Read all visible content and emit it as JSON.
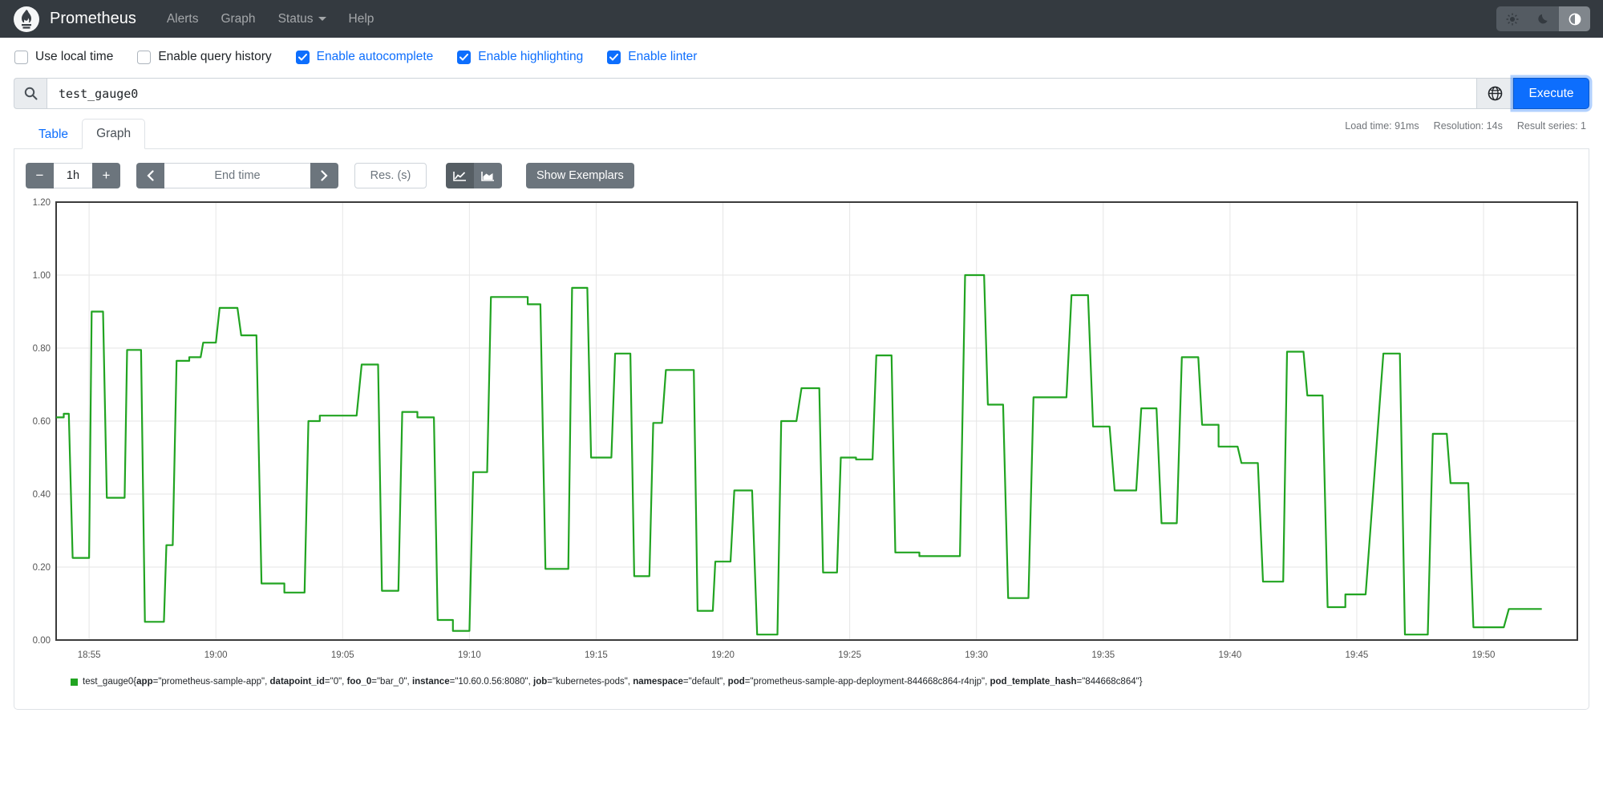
{
  "navbar": {
    "brand": "Prometheus",
    "links": [
      {
        "label": "Alerts",
        "caret": false
      },
      {
        "label": "Graph",
        "caret": false
      },
      {
        "label": "Status",
        "caret": true
      },
      {
        "label": "Help",
        "caret": false
      }
    ]
  },
  "options": [
    {
      "label": "Use local time",
      "checked": false
    },
    {
      "label": "Enable query history",
      "checked": false
    },
    {
      "label": "Enable autocomplete",
      "checked": true
    },
    {
      "label": "Enable highlighting",
      "checked": true
    },
    {
      "label": "Enable linter",
      "checked": true
    }
  ],
  "query": {
    "value": "test_gauge0",
    "execute_label": "Execute"
  },
  "stats": {
    "load_time": "Load time: 91ms",
    "resolution": "Resolution: 14s",
    "result_series": "Result series: 1"
  },
  "tabs": [
    {
      "label": "Table"
    },
    {
      "label": "Graph"
    }
  ],
  "controls": {
    "minus": "−",
    "plus": "+",
    "range": "1h",
    "prev": "‹",
    "next": "›",
    "end_time_placeholder": "End time",
    "res_placeholder": "Res. (s)",
    "show_exemplars": "Show Exemplars"
  },
  "chart_data": {
    "type": "line",
    "step": true,
    "title": "",
    "xlabel": "",
    "ylabel": "",
    "ylim": [
      0,
      1.2
    ],
    "grid": true,
    "line_color": "#21a421",
    "grid_color": "#e6e6e6",
    "border_color": "#3b3b3b",
    "tick_color": "#545454",
    "y_ticks": [
      "0.00",
      "0.20",
      "0.40",
      "0.60",
      "0.80",
      "1.00",
      "1.20"
    ],
    "x_ticks": [
      "18:55",
      "19:00",
      "19:05",
      "19:10",
      "19:15",
      "19:20",
      "19:25",
      "19:30",
      "19:35",
      "19:40",
      "19:45",
      "19:50"
    ],
    "time_domain_minutes": [
      53.7,
      113.7
    ],
    "series": [
      {
        "name": "test_gauge0",
        "segments": [
          [
            53.7,
            54,
            0.61
          ],
          [
            54,
            54.2,
            0.62
          ],
          [
            54.35,
            55,
            0.225
          ],
          [
            55.1,
            55.55,
            0.9
          ],
          [
            55.7,
            56.4,
            0.39
          ],
          [
            56.5,
            57.05,
            0.795
          ],
          [
            57.2,
            57.95,
            0.05
          ],
          [
            58.05,
            58.3,
            0.26
          ],
          [
            58.45,
            58.95,
            0.765
          ],
          [
            58.95,
            59.4,
            0.775
          ],
          [
            59.5,
            60,
            0.815
          ],
          [
            60.15,
            60.85,
            0.91
          ],
          [
            61,
            61.6,
            0.835
          ],
          [
            61.8,
            62.7,
            0.155
          ],
          [
            62.7,
            63.5,
            0.13
          ],
          [
            63.65,
            64.1,
            0.6
          ],
          [
            64.1,
            65.55,
            0.615
          ],
          [
            65.75,
            66.4,
            0.755
          ],
          [
            66.55,
            67.2,
            0.135
          ],
          [
            67.35,
            67.95,
            0.625
          ],
          [
            67.95,
            68.6,
            0.61
          ],
          [
            68.75,
            69.35,
            0.055
          ],
          [
            69.35,
            70,
            0.025
          ],
          [
            70.15,
            70.7,
            0.46
          ],
          [
            70.85,
            72.3,
            0.94
          ],
          [
            72.3,
            72.8,
            0.92
          ],
          [
            73,
            73.9,
            0.195
          ],
          [
            74.05,
            74.65,
            0.965
          ],
          [
            74.8,
            75.6,
            0.5
          ],
          [
            75.75,
            76.35,
            0.785
          ],
          [
            76.5,
            77.1,
            0.175
          ],
          [
            77.25,
            77.6,
            0.595
          ],
          [
            77.75,
            78.85,
            0.74
          ],
          [
            79,
            79.6,
            0.08
          ],
          [
            79.7,
            80.3,
            0.215
          ],
          [
            80.45,
            81.15,
            0.41
          ],
          [
            81.35,
            82.15,
            0.015
          ],
          [
            82.3,
            82.9,
            0.6
          ],
          [
            83.1,
            83.8,
            0.69
          ],
          [
            83.95,
            84.5,
            0.185
          ],
          [
            84.65,
            85.25,
            0.5
          ],
          [
            85.25,
            85.9,
            0.495
          ],
          [
            86.05,
            86.65,
            0.78
          ],
          [
            86.8,
            87.75,
            0.24
          ],
          [
            87.75,
            89.35,
            0.23
          ],
          [
            89.55,
            90.3,
            1
          ],
          [
            90.45,
            91.05,
            0.645
          ],
          [
            91.25,
            92.05,
            0.115
          ],
          [
            92.25,
            93.55,
            0.665
          ],
          [
            93.75,
            94.4,
            0.945
          ],
          [
            94.6,
            95.25,
            0.585
          ],
          [
            95.45,
            96.3,
            0.41
          ],
          [
            96.5,
            97.1,
            0.635
          ],
          [
            97.3,
            97.9,
            0.32
          ],
          [
            98.1,
            98.75,
            0.775
          ],
          [
            98.9,
            99.55,
            0.59
          ],
          [
            99.55,
            100.3,
            0.53
          ],
          [
            100.45,
            101.1,
            0.485
          ],
          [
            101.3,
            102.1,
            0.16
          ],
          [
            102.25,
            102.9,
            0.79
          ],
          [
            103.05,
            103.65,
            0.67
          ],
          [
            103.85,
            104.55,
            0.09
          ],
          [
            104.55,
            105.35,
            0.125
          ],
          [
            106.05,
            106.7,
            0.785
          ],
          [
            106.9,
            107.8,
            0.015
          ],
          [
            108,
            108.55,
            0.565
          ],
          [
            108.7,
            109.4,
            0.43
          ],
          [
            109.6,
            110.8,
            0.035
          ],
          [
            111,
            112.3,
            0.085
          ]
        ]
      }
    ]
  },
  "legend": {
    "swatch_color": "#21a421",
    "metric": "test_gauge0",
    "labels": [
      [
        "app",
        "prometheus-sample-app"
      ],
      [
        "datapoint_id",
        "0"
      ],
      [
        "foo_0",
        "bar_0"
      ],
      [
        "instance",
        "10.60.0.56:8080"
      ],
      [
        "job",
        "kubernetes-pods"
      ],
      [
        "namespace",
        "default"
      ],
      [
        "pod",
        "prometheus-sample-app-deployment-844668c864-r4njp"
      ],
      [
        "pod_template_hash",
        "844668c864"
      ]
    ]
  }
}
